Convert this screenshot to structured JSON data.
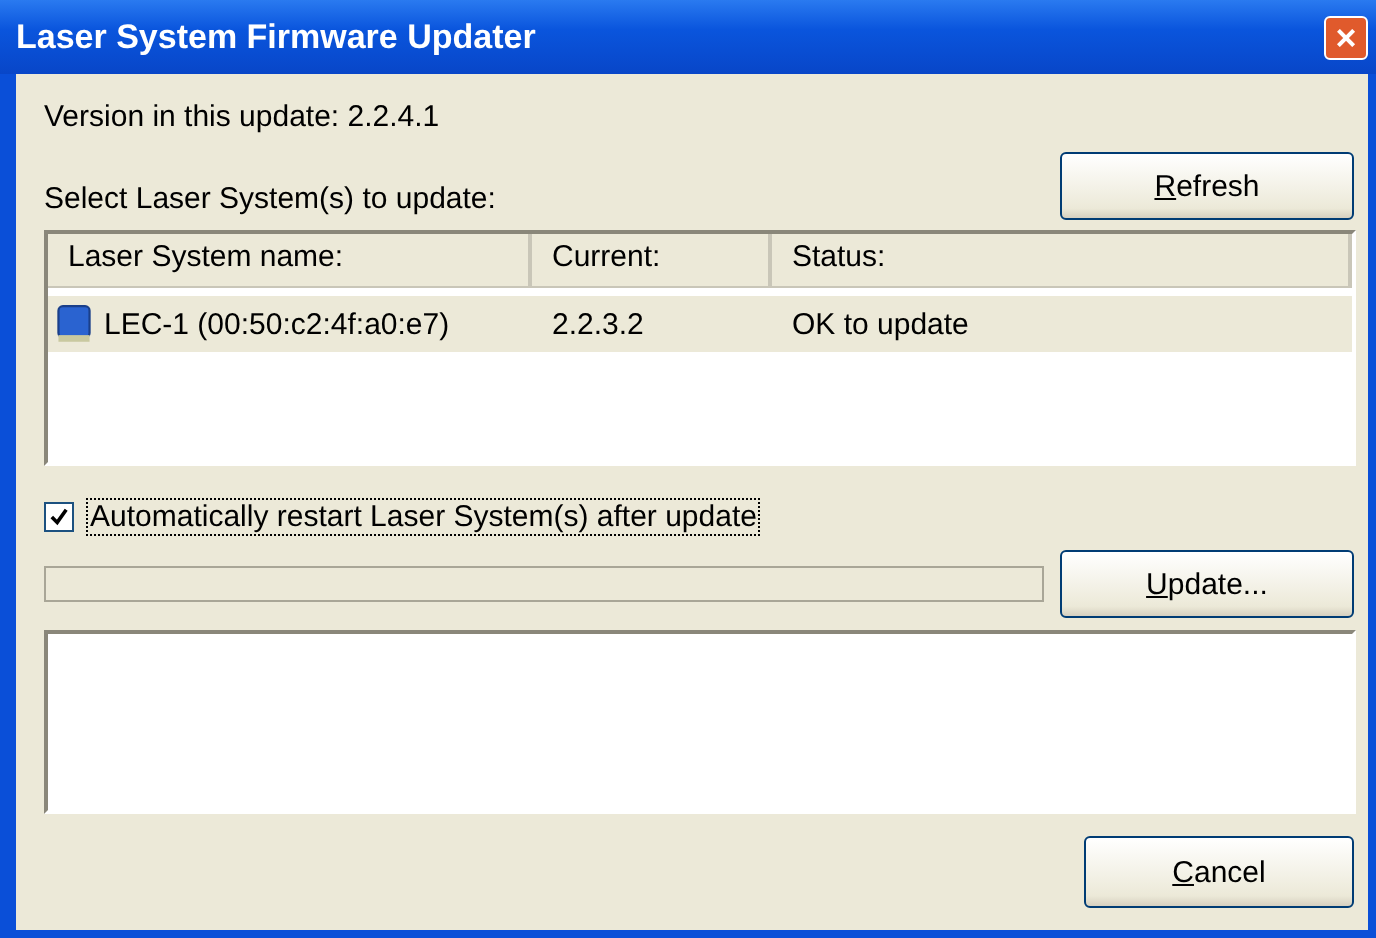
{
  "window": {
    "title": "Laser System Firmware Updater",
    "close_glyph": "×"
  },
  "version_text": "Version in this update: 2.2.4.1",
  "refresh_button": "Refresh",
  "select_label": "Select Laser System(s) to update:",
  "table": {
    "columns": [
      "Laser System name:",
      "Current:",
      "Status:"
    ],
    "rows": [
      {
        "cells": [
          "LEC-1 (00:50:c2:4f:a0:e7)",
          "2.2.3.2",
          "OK to update"
        ],
        "selected": true
      }
    ]
  },
  "auto_restart": {
    "label": "Automatically restart Laser System(s) after update",
    "checked": true
  },
  "progress": {
    "level": 0
  },
  "update_button": "Update...",
  "cancel_button": "Cancel"
}
